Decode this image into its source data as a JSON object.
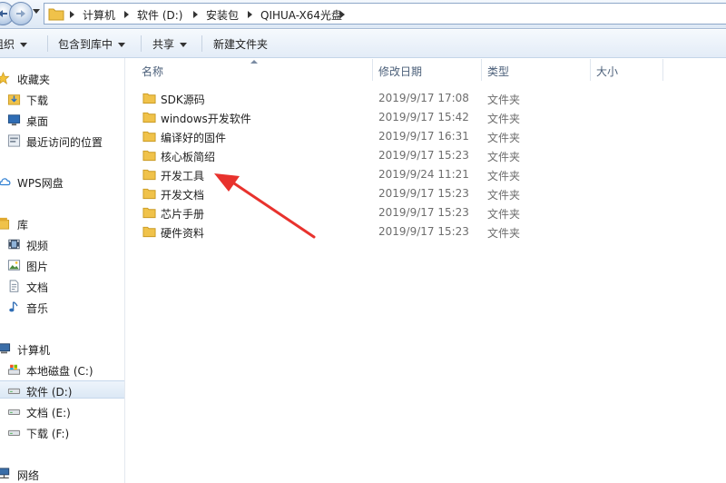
{
  "address_bar": {
    "breadcrumbs": [
      "计算机",
      "软件 (D:)",
      "安装包",
      "QIHUA-X64光盘"
    ]
  },
  "toolbar": {
    "organize_label": "组织",
    "include_label": "包含到库中",
    "share_label": "共享",
    "new_folder_label": "新建文件夹"
  },
  "nav": {
    "favorites": "收藏夹",
    "downloads": "下载",
    "desktop": "桌面",
    "recent": "最近访问的位置",
    "wps": "WPS网盘",
    "libraries": "库",
    "videos": "视频",
    "pictures": "图片",
    "documents": "文档",
    "music": "音乐",
    "computer": "计算机",
    "drive_c": "本地磁盘 (C:)",
    "drive_d": "软件 (D:)",
    "drive_e": "文档 (E:)",
    "drive_f": "下载 (F:)",
    "network": "网络"
  },
  "columns": {
    "name": "名称",
    "date": "修改日期",
    "type": "类型",
    "size": "大小"
  },
  "files": [
    {
      "name": "SDK源码",
      "date": "2019/9/17 17:08",
      "type": "文件夹"
    },
    {
      "name": "windows开发软件",
      "date": "2019/9/17 15:42",
      "type": "文件夹"
    },
    {
      "name": "编译好的固件",
      "date": "2019/9/17 16:31",
      "type": "文件夹"
    },
    {
      "name": "核心板简绍",
      "date": "2019/9/17 15:23",
      "type": "文件夹"
    },
    {
      "name": "开发工具",
      "date": "2019/9/24 11:21",
      "type": "文件夹"
    },
    {
      "name": "开发文档",
      "date": "2019/9/17 15:23",
      "type": "文件夹"
    },
    {
      "name": "芯片手册",
      "date": "2019/9/17 15:23",
      "type": "文件夹"
    },
    {
      "name": "硬件资料",
      "date": "2019/9/17 15:23",
      "type": "文件夹"
    }
  ],
  "colors": {
    "annotation_arrow": "#e8322d",
    "folder": "#f0c24a",
    "selection": "#dce8f5"
  }
}
